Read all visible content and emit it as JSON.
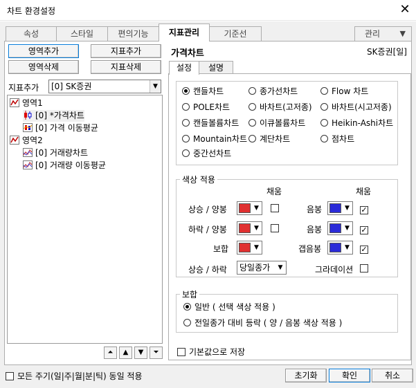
{
  "window": {
    "title": "차트 환경설정",
    "close_label": "✕"
  },
  "tabs": [
    {
      "label": "속성"
    },
    {
      "label": "스타일"
    },
    {
      "label": "편의기능"
    },
    {
      "label": "지표관리"
    },
    {
      "label": "기준선"
    },
    {
      "label": "관리"
    }
  ],
  "left": {
    "btn_area_add": "영역추가",
    "btn_indicator_add": "지표추가",
    "btn_area_delete": "영역삭제",
    "btn_indicator_delete": "지표삭제",
    "indicator_add_label": "지표추가",
    "indicator_combo_value": "[0] SK증권",
    "tree": [
      {
        "label": "영역1"
      },
      {
        "label": "[0] *가격차트"
      },
      {
        "label": "[0] 가격 이동평균"
      },
      {
        "label": "영역2"
      },
      {
        "label": "[0] 거래량차트"
      },
      {
        "label": "[0] 거래량 이동평균"
      }
    ]
  },
  "right": {
    "title": "가격차트",
    "stock_label": "SK증권[일]",
    "subtabs": [
      {
        "label": "설정"
      },
      {
        "label": "설명"
      }
    ],
    "chart_types": [
      {
        "label": "캔들차트",
        "selected": true
      },
      {
        "label": "종가선차트",
        "selected": false
      },
      {
        "label": "Flow 차트",
        "selected": false
      },
      {
        "label": "POLE차트",
        "selected": false
      },
      {
        "label": "바차트(고저종)",
        "selected": false
      },
      {
        "label": "바차트(시고저종)",
        "selected": false
      },
      {
        "label": "캔들볼륨차트",
        "selected": false
      },
      {
        "label": "이큐볼륨차트",
        "selected": false
      },
      {
        "label": "Heikin-Ashi차트",
        "selected": false
      },
      {
        "label": "Mountain차트",
        "selected": false
      },
      {
        "label": "계단차트",
        "selected": false
      },
      {
        "label": "점차트",
        "selected": false
      },
      {
        "label": "중간선차트",
        "selected": false
      }
    ],
    "color_group": {
      "title": "색상 적용",
      "fill_header_left": "채움",
      "fill_header_right": "채움",
      "rows": [
        {
          "label": "상승 / 양봉",
          "color": "#e03030",
          "fill": false,
          "right_label": "음봉",
          "right_color": "#2a2ad8",
          "right_fill": true
        },
        {
          "label": "하락 / 양봉",
          "color": "#e03030",
          "fill": false,
          "right_label": "음봉",
          "right_color": "#2a2ad8",
          "right_fill": true
        },
        {
          "label": "보합",
          "color": "#e03030",
          "right_label": "갭음봉",
          "right_color": "#2a2ad8",
          "right_fill": true
        }
      ],
      "updown_label": "상승 / 하락",
      "updown_value": "당일종가",
      "gradation_label": "그라데이션",
      "gradation_checked": false
    },
    "flat_group": {
      "title": "보합",
      "options": [
        {
          "label": "일반 ( 선택 색상 적용 )",
          "selected": true
        },
        {
          "label": "전일종가 대비 등락 ( 양 / 음봉 색상 적용 )",
          "selected": false
        }
      ]
    },
    "save_default_label": "기본값으로 저장"
  },
  "footer": {
    "apply_all_label": "모든 주기(일|주|월|분|틱) 동일 적용",
    "reset_label": "초기화",
    "ok_label": "확인",
    "cancel_label": "취소"
  },
  "colors": {
    "up": "#e03030",
    "down": "#2a2ad8",
    "accent": "#0078d7"
  }
}
